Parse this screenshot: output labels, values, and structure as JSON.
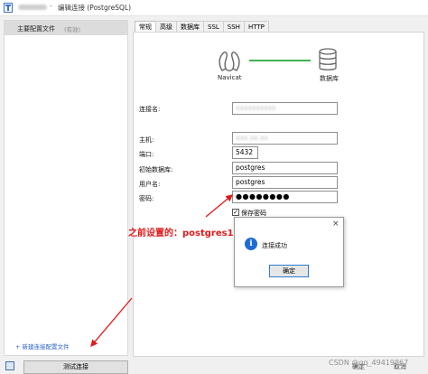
{
  "window": {
    "title": "编辑连接 (PostgreSQL)",
    "separator": "-"
  },
  "sidebar": {
    "profile_name": "主要配置文件",
    "profile_status": "(有效)",
    "new_profile": "+ 新建连接配置文件"
  },
  "tabs": [
    {
      "label": "常规",
      "active": true
    },
    {
      "label": "高级",
      "active": false
    },
    {
      "label": "数据库",
      "active": false
    },
    {
      "label": "SSL",
      "active": false
    },
    {
      "label": "SSH",
      "active": false
    },
    {
      "label": "HTTP",
      "active": false
    }
  ],
  "diagram": {
    "client_label": "Navicat",
    "server_label": "数据库",
    "line_color": "#3fb34f"
  },
  "form": {
    "connection_name_label": "连接名:",
    "connection_name_value": "xxxxxxxxxx",
    "host_label": "主机:",
    "host_value": "xxx.xx.xx",
    "port_label": "端口:",
    "port_value": "5432",
    "initial_db_label": "初始数据库:",
    "initial_db_value": "postgres",
    "username_label": "用户名:",
    "username_value": "postgres",
    "password_label": "密码:",
    "password_value": "●●●●●●●●",
    "save_password_label": "保存密码",
    "save_password_checked": true
  },
  "annotation": {
    "text": "之前设置的：postgres123",
    "color": "#e01a1a"
  },
  "dialog": {
    "message": "连接成功",
    "ok_label": "确定",
    "close_glyph": "×",
    "icon_glyph": "i"
  },
  "footer": {
    "test_button": "测试连接",
    "ok_label": "确定",
    "cancel_label": "取消",
    "watermark": "CSDN @qq_49419867"
  }
}
